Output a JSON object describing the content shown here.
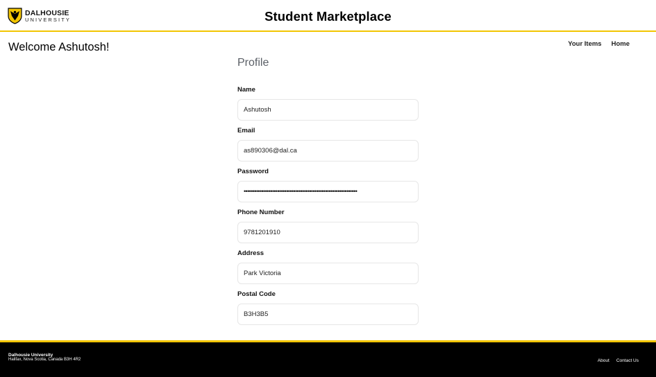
{
  "header": {
    "logo": {
      "line1": "DALHOUSIE",
      "line2": "UNIVERSITY",
      "icon": "dalhousie-shield-icon",
      "brand_color": "#f2c500"
    },
    "title": "Student Marketplace"
  },
  "welcome": "Welcome Ashutosh!",
  "nav": {
    "your_items": "Your Items",
    "home": "Home"
  },
  "profile": {
    "title": "Profile",
    "fields": [
      {
        "label": "Name",
        "value": "Ashutosh"
      },
      {
        "label": "Email",
        "value": "as890306@dal.ca"
      },
      {
        "label": "Password",
        "value": "••••••••••••••••••••••••••••••••••••••••••••••••••••••••••••••••"
      },
      {
        "label": "Phone Number",
        "value": "9781201910"
      },
      {
        "label": "Address",
        "value": "Park Victoria"
      },
      {
        "label": "Postal Code",
        "value": "B3H3B5"
      }
    ]
  },
  "footer": {
    "org_name": "Dalhousie University",
    "address": "Halifax, Nova Scotia, Canada B3H 4R2",
    "links": {
      "about": "About",
      "contact": "Contact Us"
    }
  },
  "colors": {
    "accent": "#f2c500",
    "footer_bg": "#000000",
    "profile_title": "#5a5f66"
  }
}
